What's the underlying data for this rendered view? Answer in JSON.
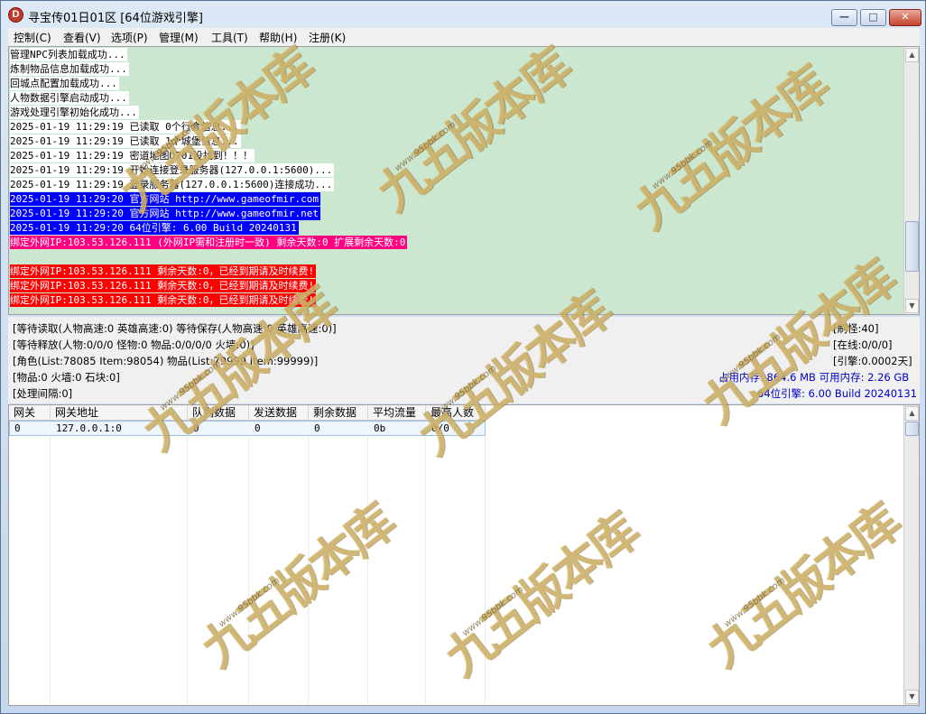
{
  "window": {
    "title": "寻宝传01日01区 [64位游戏引擎]",
    "icon_letter": "D"
  },
  "window_controls": {
    "minimize": "—",
    "maximize": "□",
    "close": "✕"
  },
  "menu": [
    {
      "label": "控制(C)"
    },
    {
      "label": "查看(V)"
    },
    {
      "label": "选项(P)"
    },
    {
      "label": "管理(M)"
    },
    {
      "label": "工具(T)"
    },
    {
      "label": "帮助(H)"
    },
    {
      "label": "注册(K)"
    }
  ],
  "log_lines": [
    {
      "text": "管理NPC列表加载成功...",
      "style": "plain"
    },
    {
      "text": "炼制物品信息加载成功...",
      "style": "plain"
    },
    {
      "text": "回城点配置加载成功...",
      "style": "plain"
    },
    {
      "text": "人物数据引擎启动成功...",
      "style": "plain"
    },
    {
      "text": "游戏处理引擎初始化成功...",
      "style": "plain"
    },
    {
      "text": "2025-01-19 11:29:19 已读取 0个行会信息...",
      "style": "plain"
    },
    {
      "text": "2025-01-19 11:29:19 已读取 1个城堡信息...",
      "style": "plain"
    },
    {
      "text": "2025-01-19 11:29:19 密道地图D701没找到！！！",
      "style": "plain"
    },
    {
      "text": "2025-01-19 11:29:19 开始连接登录服务器(127.0.0.1:5600)...",
      "style": "plain"
    },
    {
      "text": "2025-01-19 11:29:19 登录服务器(127.0.0.1:5600)连接成功...",
      "style": "plain"
    },
    {
      "text": "2025-01-19 11:29:20 官方网站 http://www.gameofmir.com",
      "style": "blue"
    },
    {
      "text": "2025-01-19 11:29:20 官方网站 http://www.gameofmir.net",
      "style": "blue"
    },
    {
      "text": "2025-01-19 11:29:20 64位引擎: 6.00 Build 20240131",
      "style": "blue"
    },
    {
      "text": "绑定外网IP:103.53.126.111 (外网IP需和注册时一致) 剩余天数:0 扩展剩余天数:0",
      "style": "pink"
    },
    {
      "text": "",
      "style": "none"
    },
    {
      "text": "绑定外网IP:103.53.126.111 剩余天数:0，已经到期请及时续费!",
      "style": "red"
    },
    {
      "text": "绑定外网IP:103.53.126.111 剩余天数:0，已经到期请及时续费!",
      "style": "red"
    },
    {
      "text": "绑定外网IP:103.53.126.111 剩余天数:0，已经到期请及时续费!",
      "style": "red"
    }
  ],
  "status": {
    "read_wait": "[等待读取(人物高速:0 英雄高速:0) 等待保存(人物高速:0 英雄高速:0)]",
    "release_wait": "[等待释放(人物:0/0/0 怪物:0 物品:0/0/0/0 火墙:0)]",
    "roles": "[角色(List:78085 Item:98054) 物品(List:79999 Item:99999)]",
    "items": "[物品:0 火墙:0 石块:0]",
    "interval": "[处理间隔:0]",
    "refresh_monster": "[刷怪:40]",
    "online": "[在线:0/0/0]",
    "engine_days": "[引擎:0.0002天]",
    "memory": "占用内存: 864.6 MB 可用内存: 2.26 GB",
    "engine_version": "64位引擎: 6.00 Build 20240131"
  },
  "grid": {
    "columns": [
      "网关",
      "网关地址",
      "队列数据",
      "发送数据",
      "剩余数据",
      "平均流量",
      "最高人数"
    ],
    "rows": [
      [
        "0",
        "127.0.0.1:0",
        "0",
        "0",
        "0",
        "0b",
        "0/0"
      ]
    ]
  },
  "watermark": {
    "text": "九五版本库",
    "url": "www.95bbk.com"
  }
}
